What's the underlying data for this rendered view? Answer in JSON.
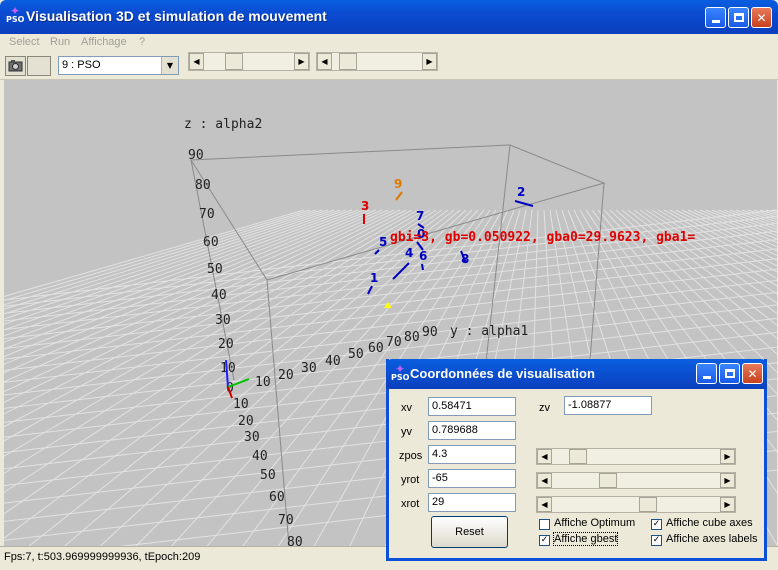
{
  "window": {
    "title": "Visualisation 3D et simulation de mouvement",
    "icon_text": "PSO",
    "controls": [
      "minimize-icon",
      "maximize-icon",
      "close-icon"
    ]
  },
  "menu": {
    "items": [
      "Select",
      "Run",
      "Affichage",
      "?"
    ]
  },
  "toolbar": {
    "combo_value": "9 : PSO"
  },
  "viewport": {
    "axis_z_label": "z : alpha2",
    "axis_y_label": "y : alpha1",
    "z_ticks": [
      "90",
      "80",
      "70",
      "60",
      "50",
      "40",
      "30",
      "20",
      "10",
      "0"
    ],
    "y_ticks": [
      "10",
      "20",
      "30",
      "40",
      "50",
      "60",
      "70",
      "80",
      "90"
    ],
    "x_ticks": [
      "0",
      "10",
      "20",
      "30",
      "40",
      "50",
      "60",
      "70",
      "80"
    ],
    "overlay_text": "gbi=3, gb=0.050922, gba0=29.9623, gba1=",
    "particles": [
      {
        "label": "9",
        "color": "#e07800"
      },
      {
        "label": "3",
        "color": "#e00000"
      },
      {
        "label": "2",
        "color": "#0000c0"
      },
      {
        "label": "7",
        "color": "#0000c0"
      },
      {
        "label": "0",
        "color": "#0000c0"
      },
      {
        "label": "5",
        "color": "#0000c0"
      },
      {
        "label": "4",
        "color": "#0000c0"
      },
      {
        "label": "6",
        "color": "#0000c0"
      },
      {
        "label": "8",
        "color": "#0000c0"
      },
      {
        "label": "1",
        "color": "#0000c0"
      },
      {
        "label": "2",
        "color": "#0000c0"
      }
    ]
  },
  "status": {
    "text": "Fps:7, t:503.969999999936, tEpoch:209"
  },
  "dialog": {
    "title": "Coordonnées de visualisation",
    "icon_text": "PSO",
    "fields": [
      {
        "label": "xv",
        "value": "0.58471"
      },
      {
        "label": "yv",
        "value": "0.789688"
      },
      {
        "label": "zpos",
        "value": "4.3"
      },
      {
        "label": "yrot",
        "value": "-65"
      },
      {
        "label": "xrot",
        "value": "29"
      }
    ],
    "zv": {
      "label": "zv",
      "value": "-1.08877"
    },
    "reset_label": "Reset",
    "checkboxes": [
      {
        "label": "Affiche Optimum",
        "checked": false
      },
      {
        "label": "Affiche gbest",
        "checked": true
      },
      {
        "label": "Affiche cube axes",
        "checked": true
      },
      {
        "label": "Affiche axes labels",
        "checked": true
      }
    ]
  }
}
